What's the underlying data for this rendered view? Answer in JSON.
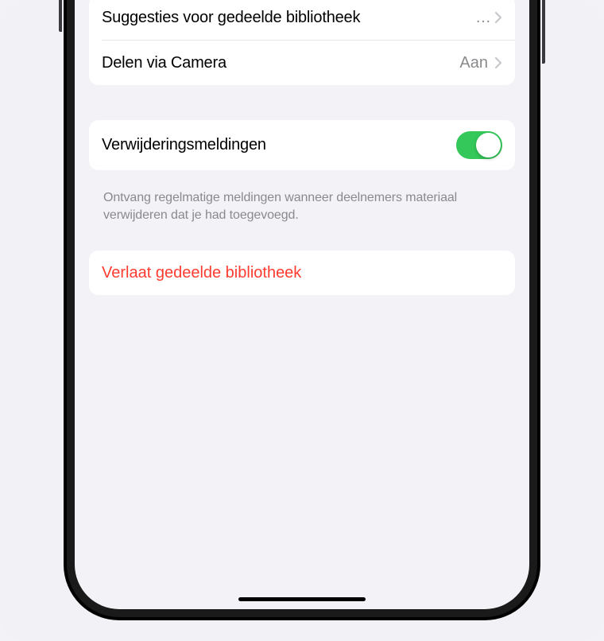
{
  "group1": {
    "row1": {
      "label": "Suggesties voor gedeelde bibliotheek",
      "truncation": "…"
    },
    "row2": {
      "label": "Delen via Camera",
      "value": "Aan"
    }
  },
  "group2": {
    "row1": {
      "label": "Verwijderingsmeldingen",
      "toggle": true
    },
    "footer": "Ontvang regelmatige meldingen wanneer deelnemers materiaal verwijderen dat je had toegevoegd."
  },
  "group3": {
    "action": "Verlaat gedeelde bibliotheek"
  }
}
